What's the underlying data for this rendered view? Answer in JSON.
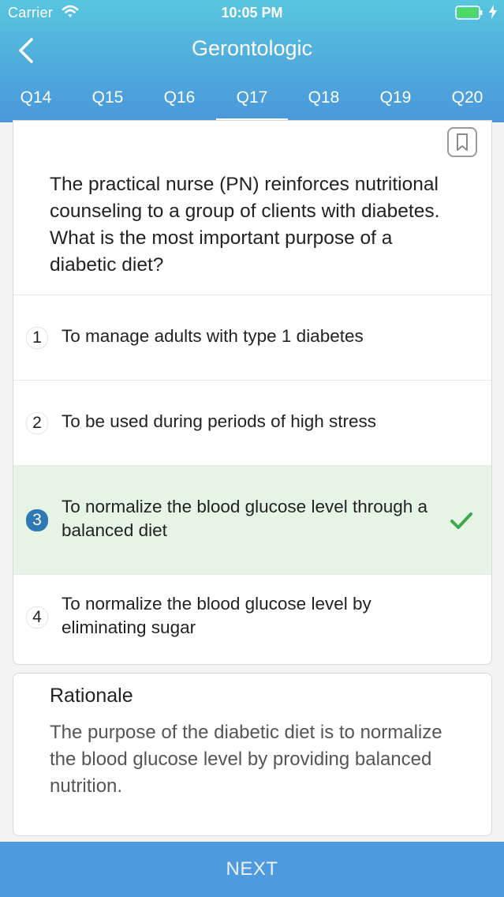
{
  "status_bar": {
    "carrier": "Carrier",
    "time": "10:05 PM"
  },
  "nav": {
    "title": "Gerontologic"
  },
  "tabs": [
    {
      "label": "Q14"
    },
    {
      "label": "Q15"
    },
    {
      "label": "Q16"
    },
    {
      "label": "Q17"
    },
    {
      "label": "Q18"
    },
    {
      "label": "Q19"
    },
    {
      "label": "Q20"
    }
  ],
  "active_tab": "Q17",
  "question": {
    "text": "The practical nurse (PN) reinforces nutritional counseling to a group of clients with diabetes. What is the most important purpose of a diabetic diet?"
  },
  "options": [
    {
      "number": "1",
      "text": "To manage adults with type 1 diabetes"
    },
    {
      "number": "2",
      "text": "To be used during periods of high stress"
    },
    {
      "number": "3",
      "text": "To normalize the blood glucose level through a balanced diet",
      "selected": true,
      "correct": true
    },
    {
      "number": "4",
      "text": "To normalize the blood glucose level by eliminating sugar"
    }
  ],
  "rationale": {
    "title": "Rationale",
    "text": "The purpose of the diabetic diet is to normalize the blood glucose level by providing balanced nutrition."
  },
  "footer": {
    "next_label": "NEXT"
  },
  "icons": {
    "wifi": "wifi-icon",
    "battery": "battery-icon",
    "back": "chevron-left-icon",
    "bookmark": "bookmark-icon",
    "check": "checkmark-icon"
  },
  "colors": {
    "header_top": "#58c6df",
    "header_bottom": "#4a98da",
    "correct_bg": "#e5f4e4",
    "check_green": "#3fa84a",
    "selected_number": "#2f79b5",
    "next_button": "#4f9ade"
  }
}
